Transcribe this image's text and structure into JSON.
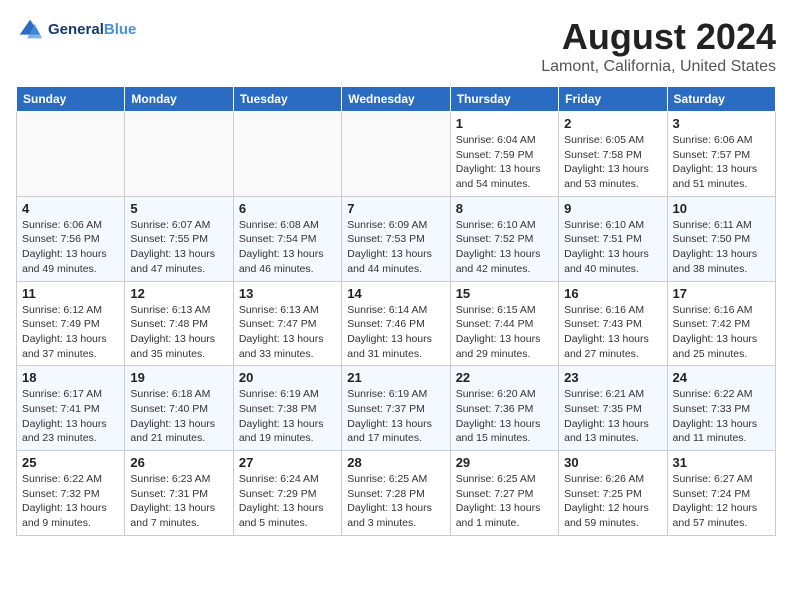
{
  "logo": {
    "line1": "General",
    "line2": "Blue"
  },
  "title": "August 2024",
  "subtitle": "Lamont, California, United States",
  "days_of_week": [
    "Sunday",
    "Monday",
    "Tuesday",
    "Wednesday",
    "Thursday",
    "Friday",
    "Saturday"
  ],
  "weeks": [
    [
      {
        "day": "",
        "sunrise": "",
        "sunset": "",
        "daylight": ""
      },
      {
        "day": "",
        "sunrise": "",
        "sunset": "",
        "daylight": ""
      },
      {
        "day": "",
        "sunrise": "",
        "sunset": "",
        "daylight": ""
      },
      {
        "day": "",
        "sunrise": "",
        "sunset": "",
        "daylight": ""
      },
      {
        "day": "1",
        "sunrise": "Sunrise: 6:04 AM",
        "sunset": "Sunset: 7:59 PM",
        "daylight": "Daylight: 13 hours and 54 minutes."
      },
      {
        "day": "2",
        "sunrise": "Sunrise: 6:05 AM",
        "sunset": "Sunset: 7:58 PM",
        "daylight": "Daylight: 13 hours and 53 minutes."
      },
      {
        "day": "3",
        "sunrise": "Sunrise: 6:06 AM",
        "sunset": "Sunset: 7:57 PM",
        "daylight": "Daylight: 13 hours and 51 minutes."
      }
    ],
    [
      {
        "day": "4",
        "sunrise": "Sunrise: 6:06 AM",
        "sunset": "Sunset: 7:56 PM",
        "daylight": "Daylight: 13 hours and 49 minutes."
      },
      {
        "day": "5",
        "sunrise": "Sunrise: 6:07 AM",
        "sunset": "Sunset: 7:55 PM",
        "daylight": "Daylight: 13 hours and 47 minutes."
      },
      {
        "day": "6",
        "sunrise": "Sunrise: 6:08 AM",
        "sunset": "Sunset: 7:54 PM",
        "daylight": "Daylight: 13 hours and 46 minutes."
      },
      {
        "day": "7",
        "sunrise": "Sunrise: 6:09 AM",
        "sunset": "Sunset: 7:53 PM",
        "daylight": "Daylight: 13 hours and 44 minutes."
      },
      {
        "day": "8",
        "sunrise": "Sunrise: 6:10 AM",
        "sunset": "Sunset: 7:52 PM",
        "daylight": "Daylight: 13 hours and 42 minutes."
      },
      {
        "day": "9",
        "sunrise": "Sunrise: 6:10 AM",
        "sunset": "Sunset: 7:51 PM",
        "daylight": "Daylight: 13 hours and 40 minutes."
      },
      {
        "day": "10",
        "sunrise": "Sunrise: 6:11 AM",
        "sunset": "Sunset: 7:50 PM",
        "daylight": "Daylight: 13 hours and 38 minutes."
      }
    ],
    [
      {
        "day": "11",
        "sunrise": "Sunrise: 6:12 AM",
        "sunset": "Sunset: 7:49 PM",
        "daylight": "Daylight: 13 hours and 37 minutes."
      },
      {
        "day": "12",
        "sunrise": "Sunrise: 6:13 AM",
        "sunset": "Sunset: 7:48 PM",
        "daylight": "Daylight: 13 hours and 35 minutes."
      },
      {
        "day": "13",
        "sunrise": "Sunrise: 6:13 AM",
        "sunset": "Sunset: 7:47 PM",
        "daylight": "Daylight: 13 hours and 33 minutes."
      },
      {
        "day": "14",
        "sunrise": "Sunrise: 6:14 AM",
        "sunset": "Sunset: 7:46 PM",
        "daylight": "Daylight: 13 hours and 31 minutes."
      },
      {
        "day": "15",
        "sunrise": "Sunrise: 6:15 AM",
        "sunset": "Sunset: 7:44 PM",
        "daylight": "Daylight: 13 hours and 29 minutes."
      },
      {
        "day": "16",
        "sunrise": "Sunrise: 6:16 AM",
        "sunset": "Sunset: 7:43 PM",
        "daylight": "Daylight: 13 hours and 27 minutes."
      },
      {
        "day": "17",
        "sunrise": "Sunrise: 6:16 AM",
        "sunset": "Sunset: 7:42 PM",
        "daylight": "Daylight: 13 hours and 25 minutes."
      }
    ],
    [
      {
        "day": "18",
        "sunrise": "Sunrise: 6:17 AM",
        "sunset": "Sunset: 7:41 PM",
        "daylight": "Daylight: 13 hours and 23 minutes."
      },
      {
        "day": "19",
        "sunrise": "Sunrise: 6:18 AM",
        "sunset": "Sunset: 7:40 PM",
        "daylight": "Daylight: 13 hours and 21 minutes."
      },
      {
        "day": "20",
        "sunrise": "Sunrise: 6:19 AM",
        "sunset": "Sunset: 7:38 PM",
        "daylight": "Daylight: 13 hours and 19 minutes."
      },
      {
        "day": "21",
        "sunrise": "Sunrise: 6:19 AM",
        "sunset": "Sunset: 7:37 PM",
        "daylight": "Daylight: 13 hours and 17 minutes."
      },
      {
        "day": "22",
        "sunrise": "Sunrise: 6:20 AM",
        "sunset": "Sunset: 7:36 PM",
        "daylight": "Daylight: 13 hours and 15 minutes."
      },
      {
        "day": "23",
        "sunrise": "Sunrise: 6:21 AM",
        "sunset": "Sunset: 7:35 PM",
        "daylight": "Daylight: 13 hours and 13 minutes."
      },
      {
        "day": "24",
        "sunrise": "Sunrise: 6:22 AM",
        "sunset": "Sunset: 7:33 PM",
        "daylight": "Daylight: 13 hours and 11 minutes."
      }
    ],
    [
      {
        "day": "25",
        "sunrise": "Sunrise: 6:22 AM",
        "sunset": "Sunset: 7:32 PM",
        "daylight": "Daylight: 13 hours and 9 minutes."
      },
      {
        "day": "26",
        "sunrise": "Sunrise: 6:23 AM",
        "sunset": "Sunset: 7:31 PM",
        "daylight": "Daylight: 13 hours and 7 minutes."
      },
      {
        "day": "27",
        "sunrise": "Sunrise: 6:24 AM",
        "sunset": "Sunset: 7:29 PM",
        "daylight": "Daylight: 13 hours and 5 minutes."
      },
      {
        "day": "28",
        "sunrise": "Sunrise: 6:25 AM",
        "sunset": "Sunset: 7:28 PM",
        "daylight": "Daylight: 13 hours and 3 minutes."
      },
      {
        "day": "29",
        "sunrise": "Sunrise: 6:25 AM",
        "sunset": "Sunset: 7:27 PM",
        "daylight": "Daylight: 13 hours and 1 minute."
      },
      {
        "day": "30",
        "sunrise": "Sunrise: 6:26 AM",
        "sunset": "Sunset: 7:25 PM",
        "daylight": "Daylight: 12 hours and 59 minutes."
      },
      {
        "day": "31",
        "sunrise": "Sunrise: 6:27 AM",
        "sunset": "Sunset: 7:24 PM",
        "daylight": "Daylight: 12 hours and 57 minutes."
      }
    ]
  ]
}
